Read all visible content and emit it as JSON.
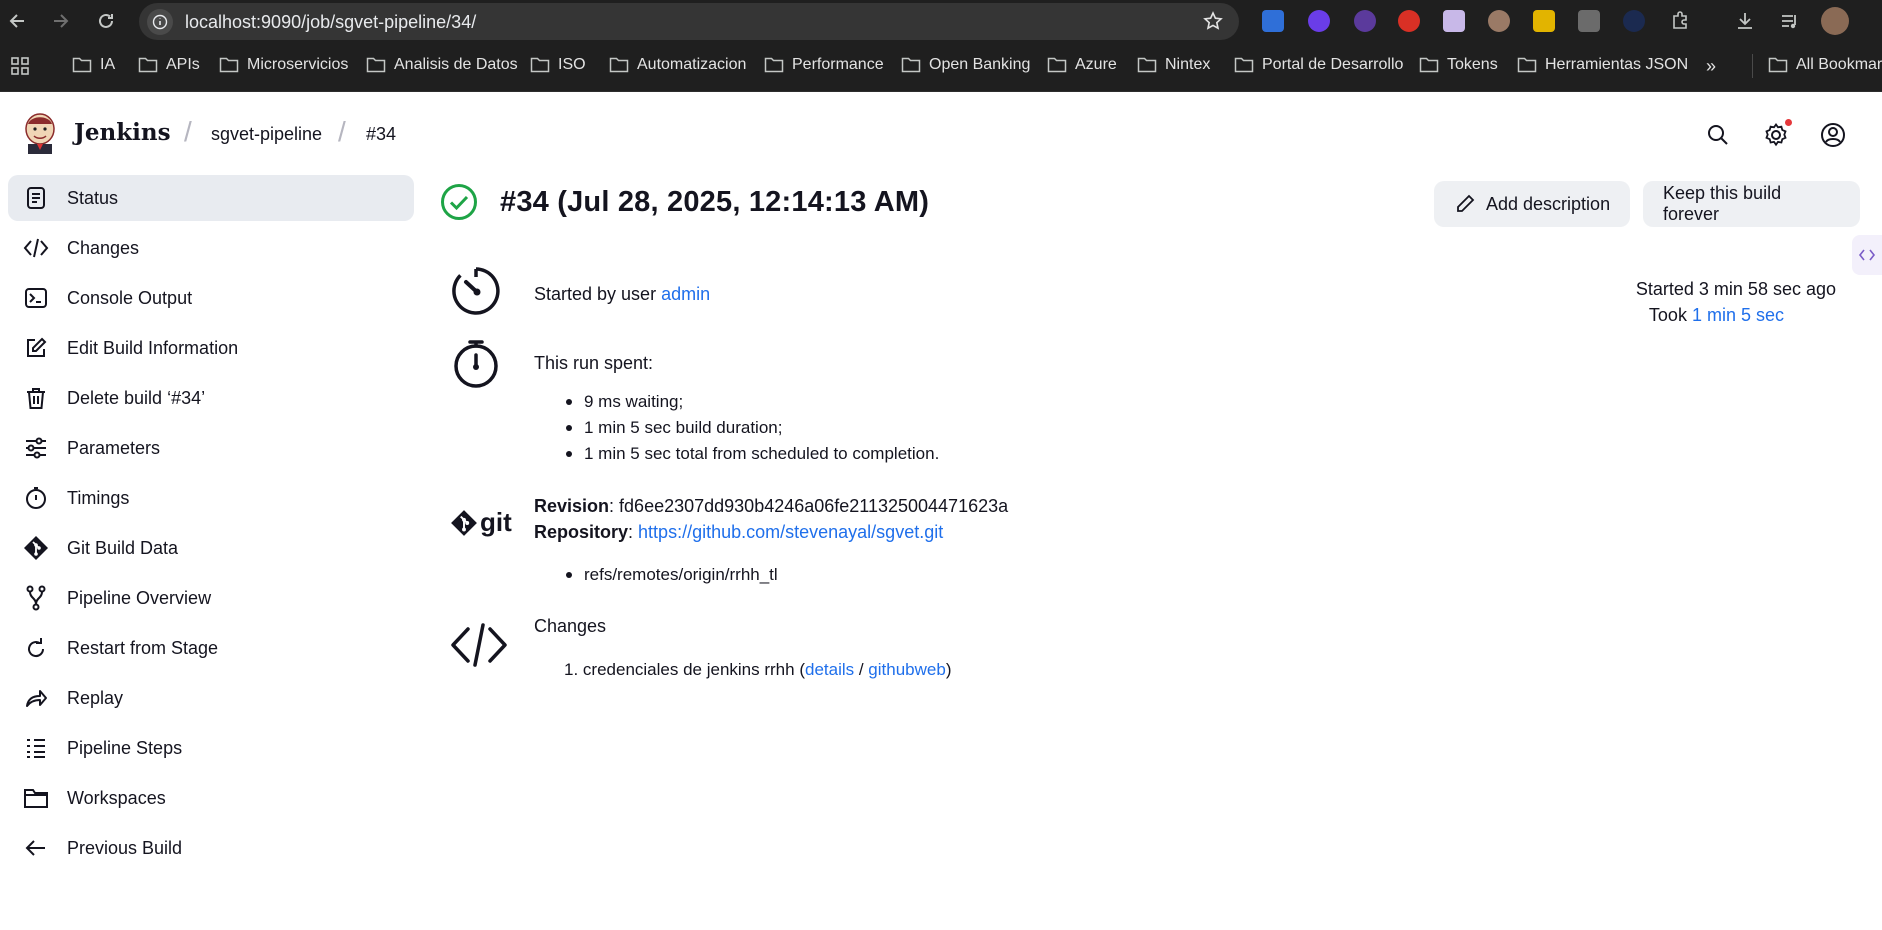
{
  "browser": {
    "url": "localhost:9090/job/sgvet-pipeline/34/",
    "bookmarks": [
      "IA",
      "APIs",
      "Microservicios",
      "Analisis de Datos",
      "ISO",
      "Automatizacion",
      "Performance",
      "Open Banking",
      "Azure",
      "Nintex",
      "Portal de Desarrollo",
      "Tokens",
      "Herramientas JSON"
    ],
    "more": "»",
    "all_bookmarks": "All Bookmarks"
  },
  "header": {
    "brand": "Jenkins",
    "breadcrumb": [
      "sgvet-pipeline",
      "#34"
    ]
  },
  "sidebar": {
    "items": [
      {
        "label": "Status",
        "icon": "status-icon"
      },
      {
        "label": "Changes",
        "icon": "code-icon"
      },
      {
        "label": "Console Output",
        "icon": "terminal-icon"
      },
      {
        "label": "Edit Build Information",
        "icon": "edit-icon"
      },
      {
        "label": "Delete build ‘#34’",
        "icon": "trash-icon"
      },
      {
        "label": "Parameters",
        "icon": "sliders-icon"
      },
      {
        "label": "Timings",
        "icon": "stopwatch-icon"
      },
      {
        "label": "Git Build Data",
        "icon": "git-icon"
      },
      {
        "label": "Pipeline Overview",
        "icon": "branch-icon"
      },
      {
        "label": "Restart from Stage",
        "icon": "restart-icon"
      },
      {
        "label": "Replay",
        "icon": "replay-icon"
      },
      {
        "label": "Pipeline Steps",
        "icon": "steps-icon"
      },
      {
        "label": "Workspaces",
        "icon": "folder-icon"
      },
      {
        "label": "Previous Build",
        "icon": "arrow-left-icon"
      }
    ]
  },
  "build": {
    "title": "#34 (Jul 28, 2025, 12:14:13 AM)",
    "add_description": "Add description",
    "keep_forever": "Keep this build forever",
    "started_by_prefix": "Started by user ",
    "started_by_user": "admin",
    "started_ago": "Started 3 min 58 sec ago",
    "took_prefix": "Took ",
    "took_link": "1 min 5 sec",
    "run_spent_label": "This run spent:",
    "run_spent": [
      "9 ms waiting;",
      "1 min 5 sec build duration;",
      "1 min 5 sec total from scheduled to completion."
    ],
    "revision_label": "Revision",
    "revision": "fd6ee2307dd930b4246a06fe211325004471623a",
    "repository_label": "Repository",
    "repository": "https://github.com/stevenayal/sgvet.git",
    "refs": [
      "refs/remotes/origin/rrhh_tl"
    ],
    "changes_label": "Changes",
    "change_number": "1.",
    "change_text": "credenciales de jenkins rrhh (",
    "change_details": "details",
    "change_slash": " / ",
    "change_githubweb": "githubweb",
    "change_close": ")",
    "git_word": "git"
  },
  "colors": {
    "link": "#1f6feb",
    "success": "#1ea446",
    "active_bg": "#e8ebf0"
  }
}
